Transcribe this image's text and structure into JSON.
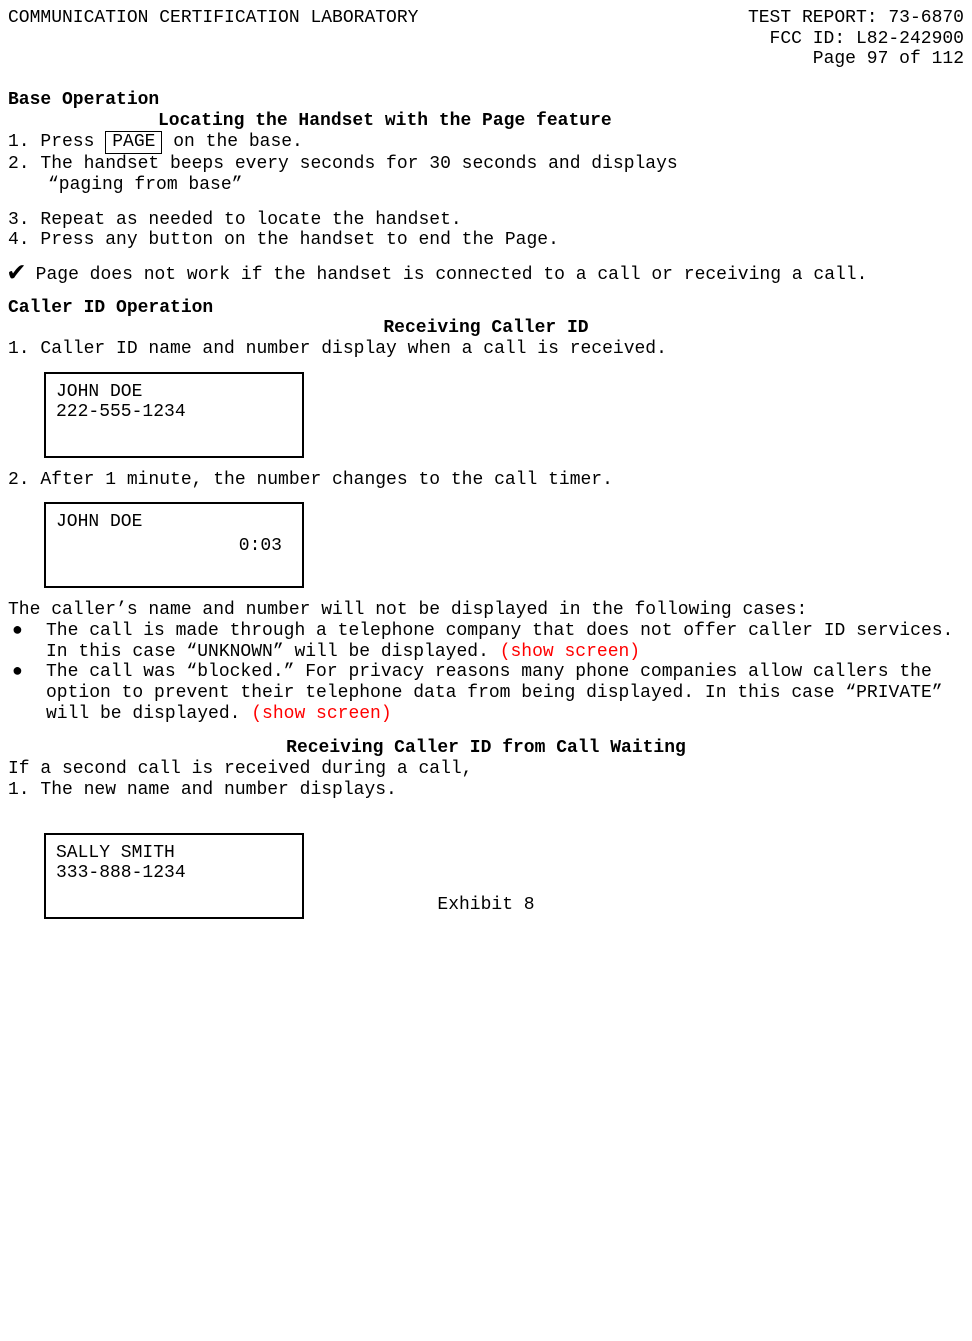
{
  "header": {
    "lab": "COMMUNICATION CERTIFICATION LABORATORY",
    "report_label": "TEST REPORT:",
    "report_num": "73-6870",
    "fcc_label": "FCC ID:",
    "fcc_id": "L82-242900",
    "page_label": "Page 97 of 112"
  },
  "base_op": {
    "title": "Base Operation",
    "subtitle": "Locating the Handset with the Page feature",
    "step1_pre": "1. Press ",
    "page_btn": "PAGE",
    "step1_post": " on the base.",
    "step2a": "2. The handset beeps every seconds for 30 seconds and displays",
    "step2b": "“paging from base”",
    "step3": "3. Repeat as needed to locate the handset.",
    "step4": "4. Press any button on the handset to end the Page.",
    "note": "Page does not work if the handset is connected to a call or receiving a call."
  },
  "caller_id": {
    "title": "Caller ID Operation",
    "subtitle": "Receiving Caller ID",
    "step1": "1. Caller ID name and number display when a call is received.",
    "display1_name": "JOHN DOE",
    "display1_num": "222-555-1234",
    "step2": "2. After 1 minute, the number changes to the call timer.",
    "display2_name": "JOHN DOE",
    "display2_timer": "0:03",
    "cases_intro": "The caller’s name and number will not be displayed in the following cases:",
    "bullet1a": "The call is made through a telephone company that does not offer caller ID services.  In this case “UNKNOWN” will be displayed. ",
    "bullet1_red": "(show screen)",
    "bullet2a": "The call was “blocked.”  For privacy reasons many phone companies allow callers the option to prevent their telephone data from being displayed.  In this case “PRIVATE” will be displayed. ",
    "bullet2_red": "(show screen)"
  },
  "call_waiting": {
    "subtitle": "Receiving Caller ID from Call Waiting",
    "intro": "If a second call is received during a call,",
    "step1": "1. The new name and number displays.",
    "display_name": "SALLY SMITH",
    "display_num": "333-888-1234"
  },
  "footer": {
    "exhibit": "Exhibit 8"
  }
}
